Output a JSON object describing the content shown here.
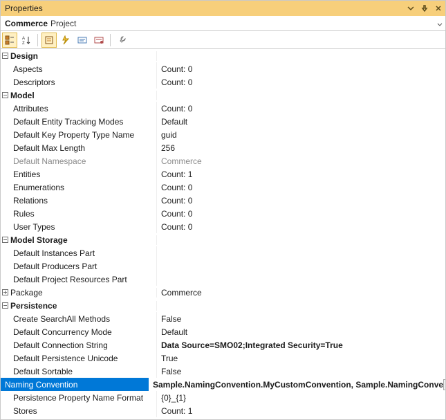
{
  "panel": {
    "title": "Properties"
  },
  "context": {
    "object_name": "Commerce",
    "object_type": "Project"
  },
  "categories": {
    "design": {
      "label": "Design",
      "expanded": true,
      "props": {
        "aspects": {
          "label": "Aspects",
          "value": "Count: 0"
        },
        "descriptors": {
          "label": "Descriptors",
          "value": "Count: 0"
        }
      }
    },
    "model": {
      "label": "Model",
      "expanded": true,
      "props": {
        "attributes": {
          "label": "Attributes",
          "value": "Count: 0"
        },
        "default_entity_tracking_modes": {
          "label": "Default Entity Tracking Modes",
          "value": "Default"
        },
        "default_key_property_type_name": {
          "label": "Default Key Property Type Name",
          "value": "guid"
        },
        "default_max_length": {
          "label": "Default Max Length",
          "value": "256"
        },
        "default_namespace": {
          "label": "Default Namespace",
          "value": "Commerce",
          "disabled": true
        },
        "entities": {
          "label": "Entities",
          "value": "Count: 1"
        },
        "enumerations": {
          "label": "Enumerations",
          "value": "Count: 0"
        },
        "relations": {
          "label": "Relations",
          "value": "Count: 0"
        },
        "rules": {
          "label": "Rules",
          "value": "Count: 0"
        },
        "user_types": {
          "label": "User Types",
          "value": "Count: 0"
        }
      }
    },
    "model_storage": {
      "label": "Model Storage",
      "expanded": true,
      "props": {
        "default_instances_part": {
          "label": "Default Instances Part",
          "value": ""
        },
        "default_producers_part": {
          "label": "Default Producers Part",
          "value": ""
        },
        "default_project_resources_part": {
          "label": "Default Project Resources Part",
          "value": ""
        }
      }
    },
    "package": {
      "label": "Package",
      "expanded": false,
      "value": "Commerce"
    },
    "persistence": {
      "label": "Persistence",
      "expanded": true,
      "props": {
        "create_searchall_methods": {
          "label": "Create SearchAll Methods",
          "value": "False"
        },
        "default_concurrency_mode": {
          "label": "Default Concurrency Mode",
          "value": "Default"
        },
        "default_connection_string": {
          "label": "Default Connection String",
          "value": "Data Source=SMO02;Integrated Security=True",
          "bold": true
        },
        "default_persistence_unicode": {
          "label": "Default Persistence Unicode",
          "value": "True"
        },
        "default_sortable": {
          "label": "Default Sortable",
          "value": "False"
        },
        "naming_convention": {
          "label": "Naming Convention",
          "value": "Sample.NamingConvention.MyCustomConvention, Sample.NamingConve",
          "bold": true,
          "selected": true,
          "dropdown": true
        },
        "persistence_property_name_format": {
          "label": "Persistence Property Name Format",
          "value": "{0}_{1}"
        },
        "stores": {
          "label": "Stores",
          "value": "Count: 1"
        }
      }
    }
  }
}
